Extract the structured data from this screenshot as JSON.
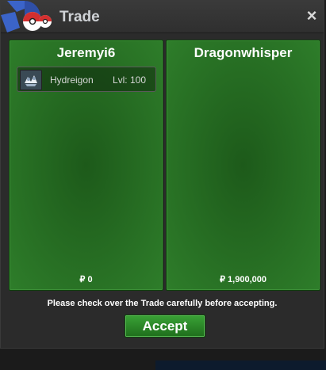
{
  "window": {
    "title": "Trade",
    "close_symbol": "×"
  },
  "left_panel": {
    "player_name": "Jeremyi6",
    "item": {
      "icon": "hydreigon-sprite-icon",
      "name": "Hydreigon",
      "level": "Lvl: 100"
    },
    "money": "₽ 0"
  },
  "right_panel": {
    "player_name": "Dragonwhisper",
    "money": "₽ 1,900,000"
  },
  "notice": "Please check over the Trade carefully before accepting.",
  "accept_label": "Accept",
  "colors": {
    "panel_green": "#2e7d2a",
    "button_green": "#3aa236",
    "window_bg": "#2b2b2b"
  }
}
